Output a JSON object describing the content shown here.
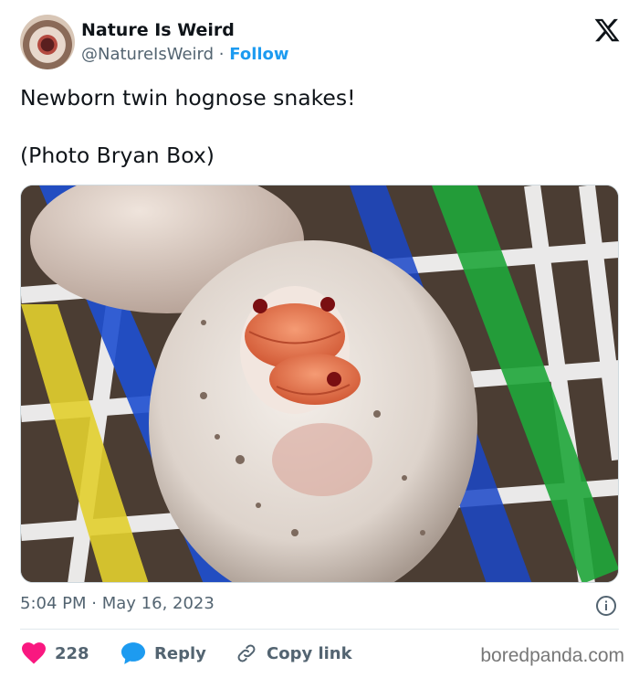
{
  "author": {
    "name": "Nature Is Weird",
    "handle": "@NatureIsWeird",
    "separator": "·",
    "follow_label": "Follow",
    "avatar_icon": "avatar-egg-snake"
  },
  "platform_icon": "x-logo-icon",
  "tweet": {
    "line1": "Newborn twin hognose snakes!",
    "line2": "(Photo Bryan Box)"
  },
  "image": {
    "icon": "photo-twin-snakes-hatching-from-egg"
  },
  "meta": {
    "time": "5:04 PM",
    "separator": "·",
    "date": "May 16, 2023"
  },
  "actions": {
    "likes_count": "228",
    "reply_label": "Reply",
    "copy_link_label": "Copy link"
  },
  "watermark": "boredpanda.com",
  "colors": {
    "accent": "#1d9bf0",
    "like": "#f91880",
    "text": "#0f1419",
    "muted": "#536471"
  }
}
